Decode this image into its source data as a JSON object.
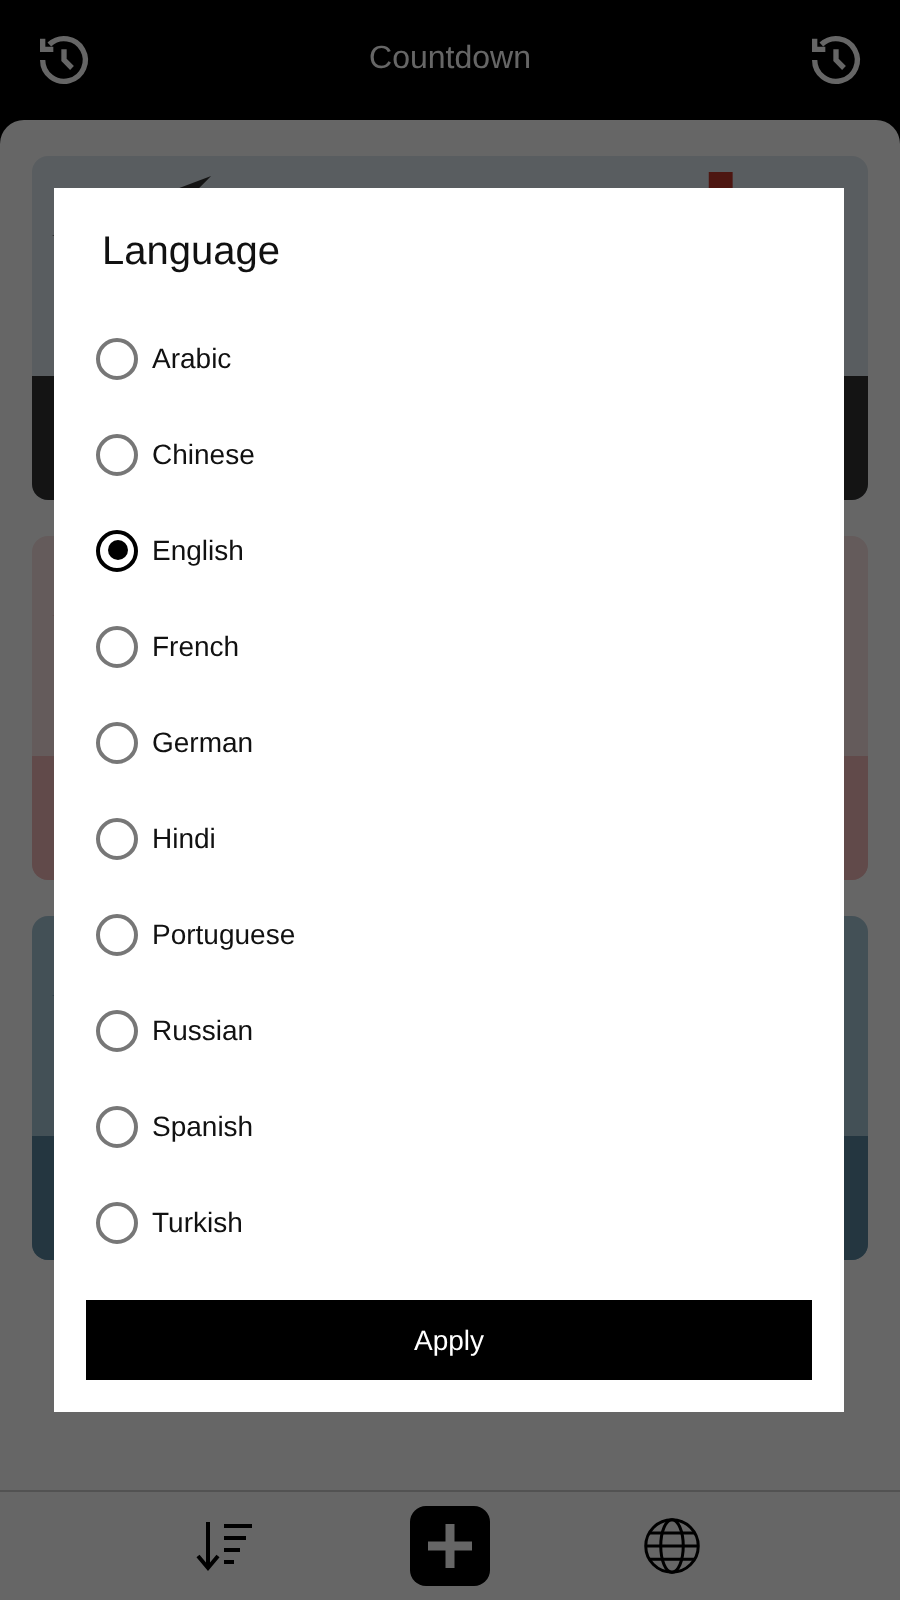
{
  "header": {
    "title": "Countdown"
  },
  "dialog": {
    "title": "Language",
    "options": [
      {
        "label": "Arabic",
        "selected": false
      },
      {
        "label": "Chinese",
        "selected": false
      },
      {
        "label": "English",
        "selected": true
      },
      {
        "label": "French",
        "selected": false
      },
      {
        "label": "German",
        "selected": false
      },
      {
        "label": "Hindi",
        "selected": false
      },
      {
        "label": "Portuguese",
        "selected": false
      },
      {
        "label": "Russian",
        "selected": false
      },
      {
        "label": "Spanish",
        "selected": false
      },
      {
        "label": "Turkish",
        "selected": false
      }
    ],
    "button": "Apply"
  }
}
